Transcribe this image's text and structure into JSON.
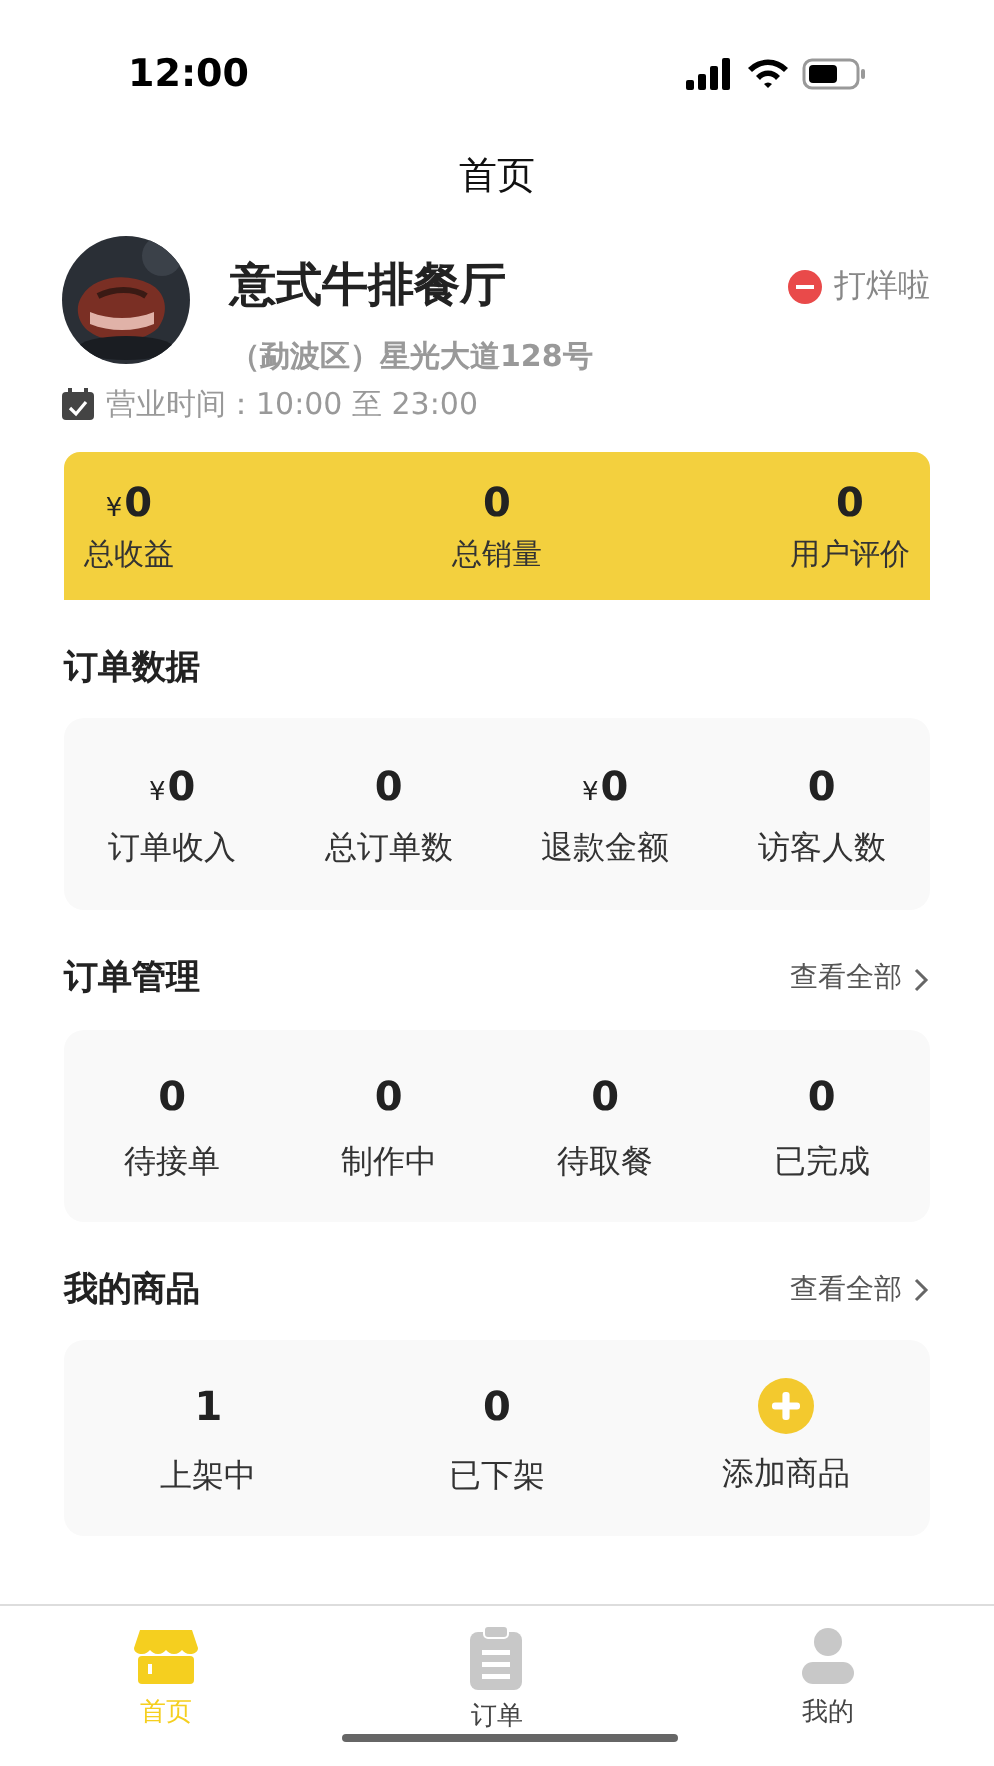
{
  "status_bar": {
    "time": "12:00"
  },
  "nav": {
    "title": "首页"
  },
  "store": {
    "name": "意式牛排餐厅",
    "address": "（勐波区）星光大道128号",
    "hours_label": "营业时间：",
    "hours": "10:00 至 23:00",
    "status": "打烊啦"
  },
  "summary": [
    {
      "currency": "¥",
      "value": "0",
      "label": "总收益"
    },
    {
      "value": "0",
      "label": "总销量"
    },
    {
      "value": "0",
      "label": "用户评价"
    }
  ],
  "order_data": {
    "title": "订单数据",
    "stats": [
      {
        "currency": "¥",
        "value": "0",
        "label": "订单收入"
      },
      {
        "value": "0",
        "label": "总订单数"
      },
      {
        "currency": "¥",
        "value": "0",
        "label": "退款金额"
      },
      {
        "value": "0",
        "label": "访客人数"
      }
    ]
  },
  "order_management": {
    "title": "订单管理",
    "link": "查看全部",
    "stats": [
      {
        "value": "0",
        "label": "待接单"
      },
      {
        "value": "0",
        "label": "制作中"
      },
      {
        "value": "0",
        "label": "待取餐"
      },
      {
        "value": "0",
        "label": "已完成"
      }
    ]
  },
  "products": {
    "title": "我的商品",
    "link": "查看全部",
    "items": [
      {
        "kind": "stat",
        "value": "1",
        "label": "上架中"
      },
      {
        "kind": "stat",
        "value": "0",
        "label": "已下架"
      },
      {
        "kind": "add",
        "label": "添加商品"
      }
    ]
  },
  "tab_bar": [
    {
      "kind": "store",
      "label": "首页",
      "selected": true
    },
    {
      "kind": "orders",
      "label": "订单",
      "selected": false
    },
    {
      "kind": "profile",
      "label": "我的",
      "selected": false
    }
  ]
}
